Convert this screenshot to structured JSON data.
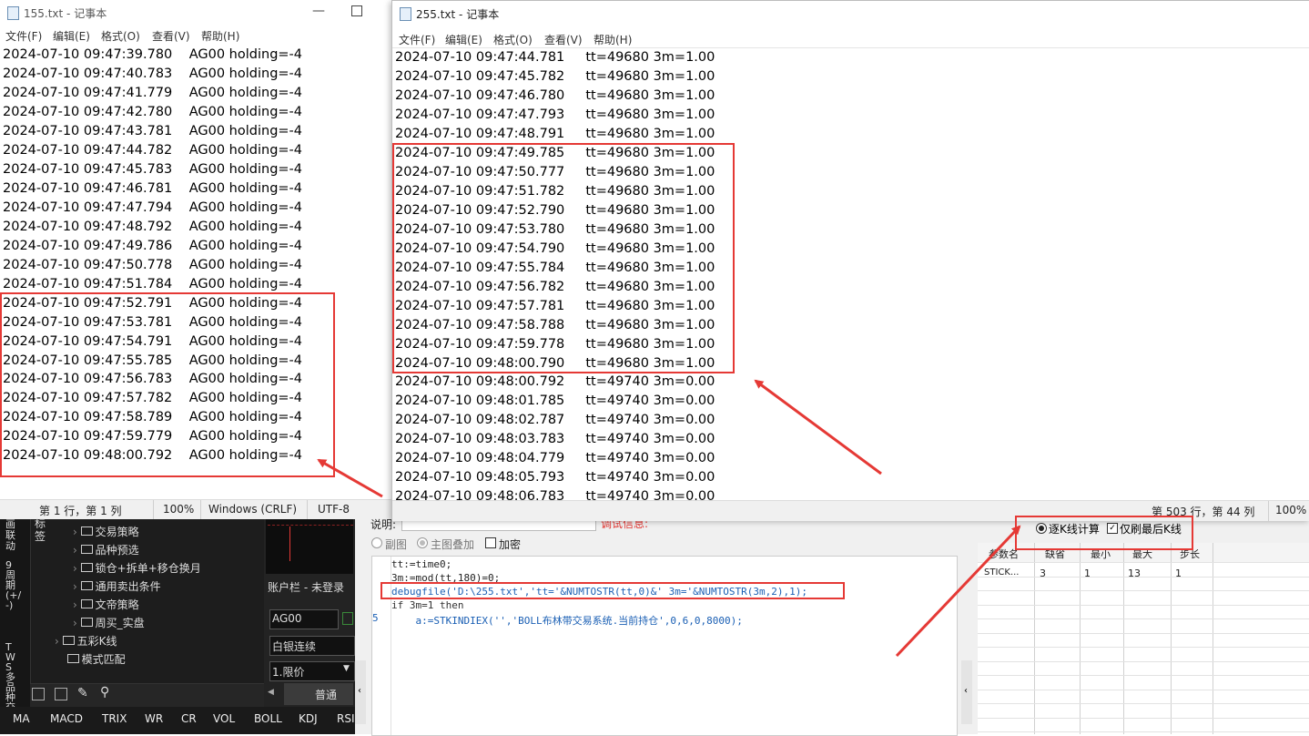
{
  "back_window": {
    "title": "155.txt - 记事本",
    "menu": [
      "文件(F)",
      "编辑(E)",
      "格式(O)",
      "查看(V)",
      "帮助(H)"
    ],
    "lines": [
      "2024-07-10 09:47:39.780    AG00 holding=-4",
      "2024-07-10 09:47:40.783    AG00 holding=-4",
      "2024-07-10 09:47:41.779    AG00 holding=-4",
      "2024-07-10 09:47:42.780    AG00 holding=-4",
      "2024-07-10 09:47:43.781    AG00 holding=-4",
      "2024-07-10 09:47:44.782    AG00 holding=-4",
      "2024-07-10 09:47:45.783    AG00 holding=-4",
      "2024-07-10 09:47:46.781    AG00 holding=-4",
      "2024-07-10 09:47:47.794    AG00 holding=-4",
      "2024-07-10 09:47:48.792    AG00 holding=-4",
      "2024-07-10 09:47:49.786    AG00 holding=-4",
      "2024-07-10 09:47:50.778    AG00 holding=-4",
      "2024-07-10 09:47:51.784    AG00 holding=-4",
      "2024-07-10 09:47:52.791    AG00 holding=-4",
      "2024-07-10 09:47:53.781    AG00 holding=-4",
      "2024-07-10 09:47:54.791    AG00 holding=-4",
      "2024-07-10 09:47:55.785    AG00 holding=-4",
      "2024-07-10 09:47:56.783    AG00 holding=-4",
      "2024-07-10 09:47:57.782    AG00 holding=-4",
      "2024-07-10 09:47:58.789    AG00 holding=-4",
      "2024-07-10 09:47:59.779    AG00 holding=-4",
      "2024-07-10 09:48:00.792    AG00 holding=-4"
    ],
    "status": {
      "position": "第 1 行，第 1 列",
      "zoom": "100%",
      "eol": "Windows (CRLF)",
      "encoding": "UTF-8"
    }
  },
  "front_window": {
    "title": "255.txt - 记事本",
    "menu": [
      "文件(F)",
      "编辑(E)",
      "格式(O)",
      "查看(V)",
      "帮助(H)"
    ],
    "lines": [
      "2024-07-10 09:47:44.781     tt=49680 3m=1.00",
      "2024-07-10 09:47:45.782     tt=49680 3m=1.00",
      "2024-07-10 09:47:46.780     tt=49680 3m=1.00",
      "2024-07-10 09:47:47.793     tt=49680 3m=1.00",
      "2024-07-10 09:47:48.791     tt=49680 3m=1.00",
      "2024-07-10 09:47:49.785     tt=49680 3m=1.00",
      "2024-07-10 09:47:50.777     tt=49680 3m=1.00",
      "2024-07-10 09:47:51.782     tt=49680 3m=1.00",
      "2024-07-10 09:47:52.790     tt=49680 3m=1.00",
      "2024-07-10 09:47:53.780     tt=49680 3m=1.00",
      "2024-07-10 09:47:54.790     tt=49680 3m=1.00",
      "2024-07-10 09:47:55.784     tt=49680 3m=1.00",
      "2024-07-10 09:47:56.782     tt=49680 3m=1.00",
      "2024-07-10 09:47:57.781     tt=49680 3m=1.00",
      "2024-07-10 09:47:58.788     tt=49680 3m=1.00",
      "2024-07-10 09:47:59.778     tt=49680 3m=1.00",
      "2024-07-10 09:48:00.790     tt=49680 3m=1.00",
      "2024-07-10 09:48:00.792     tt=49740 3m=0.00",
      "2024-07-10 09:48:01.785     tt=49740 3m=0.00",
      "2024-07-10 09:48:02.787     tt=49740 3m=0.00",
      "2024-07-10 09:48:03.783     tt=49740 3m=0.00",
      "2024-07-10 09:48:04.779     tt=49740 3m=0.00",
      "2024-07-10 09:48:05.793     tt=49740 3m=0.00",
      "2024-07-10 09:48:06.783     tt=49740 3m=0.00"
    ],
    "status": {
      "position": "第 503 行，第 44 列",
      "zoom": "100%"
    }
  },
  "sidebar": {
    "vertical_tabs": [
      "标签",
      "画联动",
      "9周期(+/-)",
      "TWS多品种交"
    ],
    "tree": [
      "交易策略",
      "品种预选",
      "锁仓+拆单+移仓换月",
      "通用卖出条件",
      "文帝策略",
      "周买_实盘",
      "五彩K线",
      "模式匹配"
    ]
  },
  "account": {
    "label": "账户栏 - 未登录",
    "symbol": "AG00",
    "strategy": "白银连续",
    "order_type": "1.限价",
    "order_mode": "普通"
  },
  "indicator_tabs": [
    "MA",
    "MACD",
    "TRIX",
    "WR",
    "CR",
    "VOL",
    "BOLL",
    "KDJ",
    "RSI"
  ],
  "editor": {
    "desc_label": "说明:",
    "debug_label": "调试信息:",
    "radio_sub": "副图",
    "radio_main": "主图叠加",
    "checkbox_encrypt": "加密",
    "code": [
      "tt:=time0;",
      "3m:=mod(tt,180)=0;",
      "debugfile('D:\\255.txt','tt='&NUMTOSTR(tt,0)&' 3m='&NUMTOSTR(3m,2),1);",
      "if 3m=1 then",
      "    a:=STKINDIEX('','BOLL布林带交易系统.当前持仓',0,6,0,8000);"
    ],
    "line_number_5": "5"
  },
  "params": {
    "radio_tick": "逐K线计算",
    "checkbox_last": "仅刷最后K线",
    "headers": [
      "参数名",
      "缺省",
      "最小",
      "最大",
      "步长"
    ],
    "row": [
      "STICK...",
      "3",
      "1",
      "13",
      "1"
    ]
  }
}
